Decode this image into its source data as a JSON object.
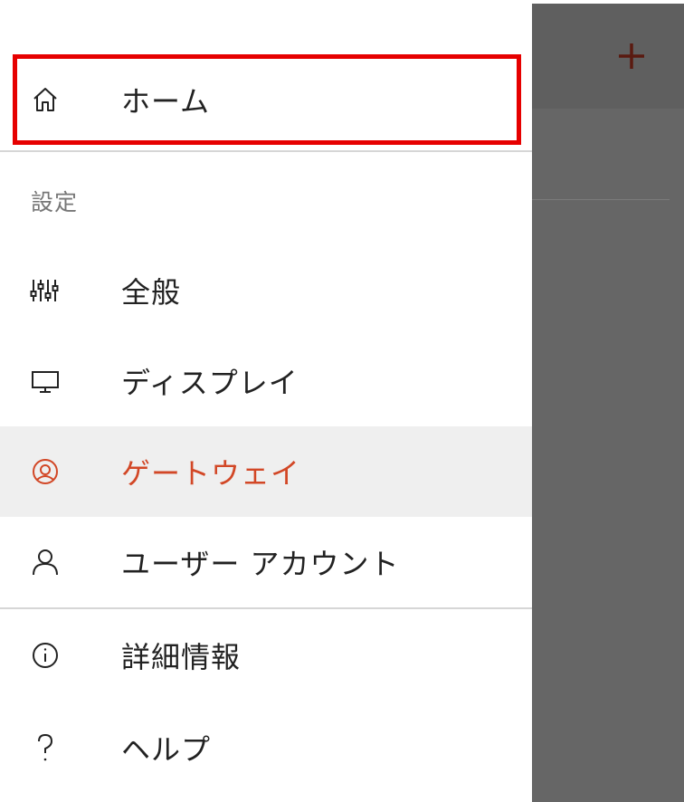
{
  "background": {
    "add_icon": "plus-icon"
  },
  "drawer": {
    "home": {
      "label": "ホーム",
      "icon": "home-icon"
    },
    "settings_section": {
      "heading": "設定",
      "items": [
        {
          "label": "全般",
          "icon": "sliders-icon"
        },
        {
          "label": "ディスプレイ",
          "icon": "monitor-icon"
        },
        {
          "label": "ゲートウェイ",
          "icon": "gateway-icon",
          "selected": true
        },
        {
          "label": "ユーザー アカウント",
          "icon": "user-icon"
        }
      ]
    },
    "footer_items": [
      {
        "label": "詳細情報",
        "icon": "info-icon"
      },
      {
        "label": "ヘルプ",
        "icon": "help-icon"
      }
    ]
  },
  "colors": {
    "accent": "#d24726",
    "highlight_border": "#e60000",
    "selected_bg": "#efefef",
    "overlay": "#666666"
  }
}
